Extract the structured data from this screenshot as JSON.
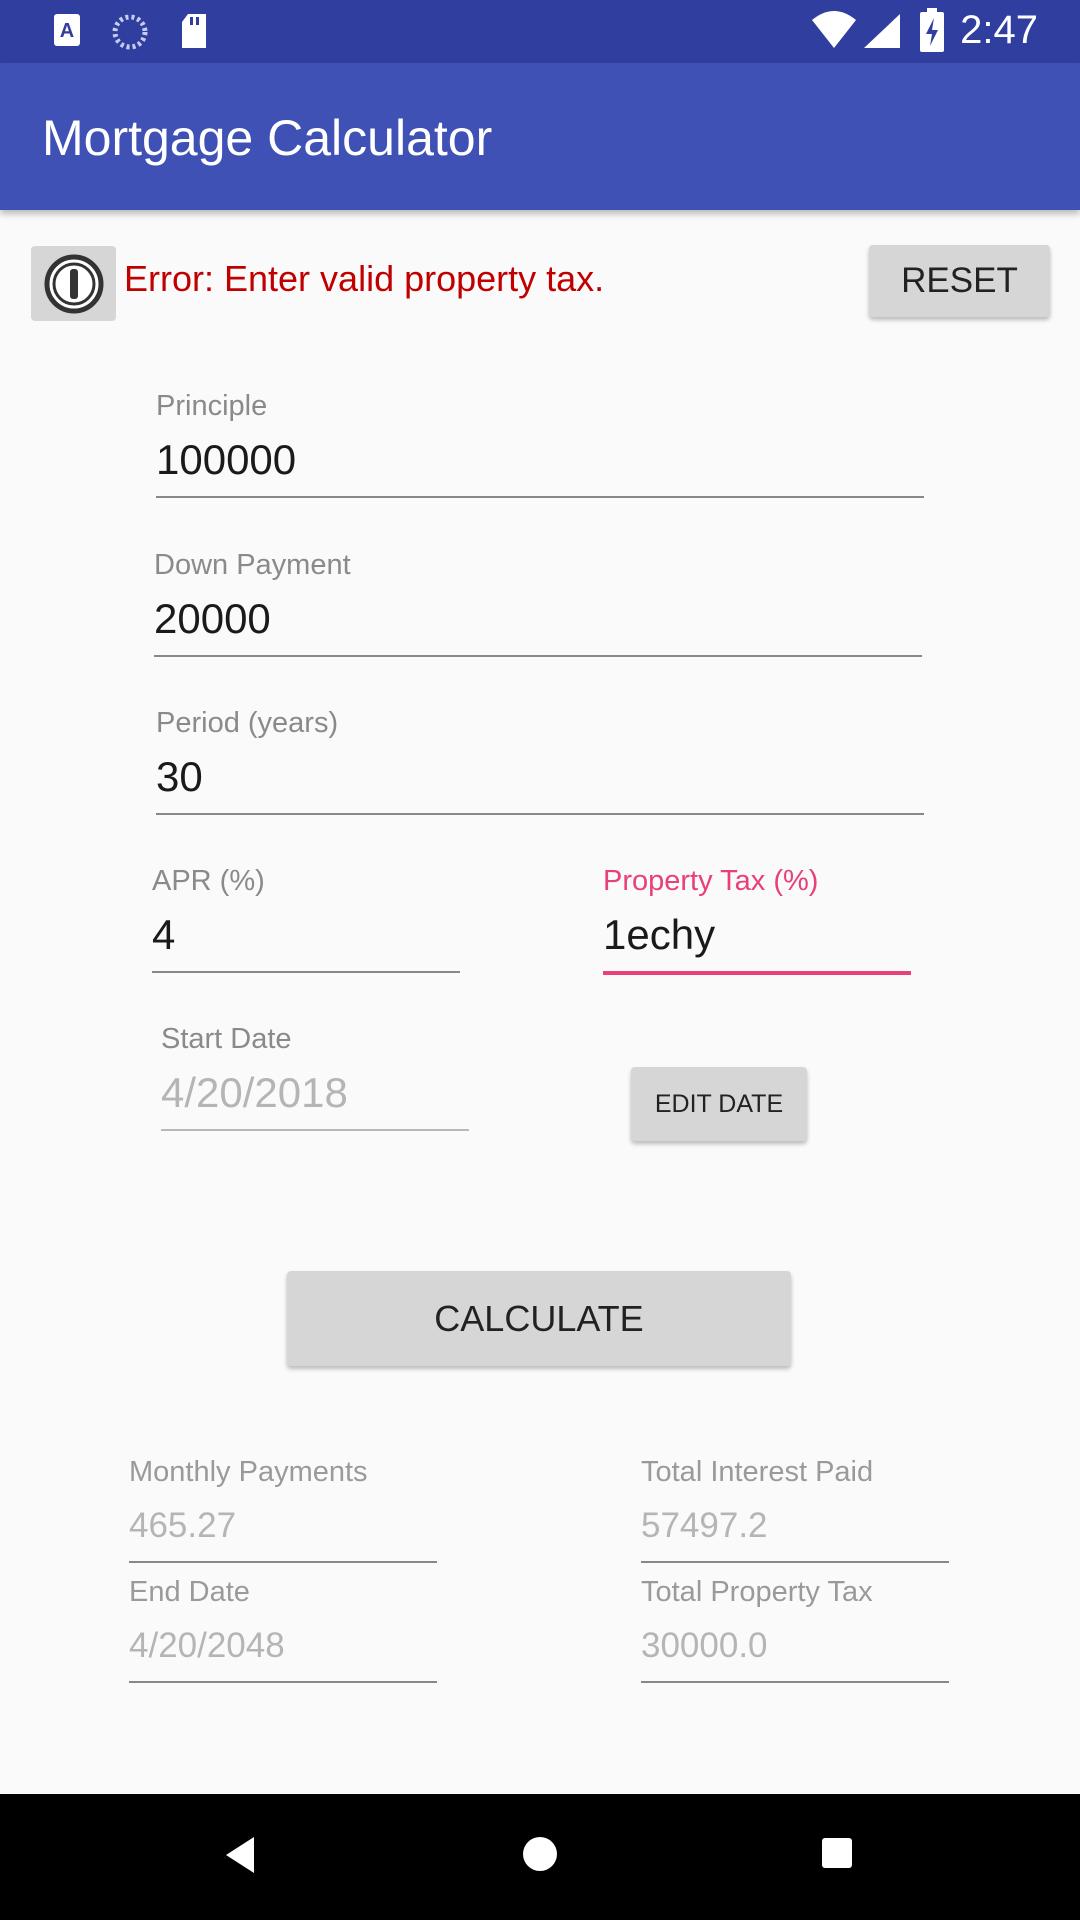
{
  "status_bar": {
    "time": "2:47",
    "icons": [
      "a-notification-icon",
      "sync-icon",
      "sd-card-icon",
      "wifi-icon",
      "signal-icon",
      "battery-charging-icon"
    ]
  },
  "app_bar": {
    "title": "Mortgage Calculator"
  },
  "error": {
    "message": "Error: Enter valid property tax."
  },
  "buttons": {
    "reset": "RESET",
    "edit_date": "EDIT DATE",
    "calculate": "CALCULATE"
  },
  "form": {
    "principle": {
      "label": "Principle",
      "value": "100000"
    },
    "down_payment": {
      "label": "Down Payment",
      "value": "20000"
    },
    "period": {
      "label": "Period (years)",
      "value": "30"
    },
    "apr": {
      "label": "APR (%)",
      "value": "4"
    },
    "property_tax": {
      "label": "Property Tax (%)",
      "value": "1echy"
    },
    "start_date": {
      "label": "Start Date",
      "value": "4/20/2018"
    }
  },
  "results": {
    "monthly_payments": {
      "label": "Monthly Payments",
      "value": "465.27"
    },
    "total_interest": {
      "label": "Total Interest Paid",
      "value": "57497.2"
    },
    "end_date": {
      "label": "End Date",
      "value": "4/20/2048"
    },
    "total_property_tax": {
      "label": "Total Property Tax",
      "value": "30000.0"
    }
  },
  "colors": {
    "status_bar": "#303f9f",
    "app_bar": "#3f51b5",
    "accent": "#e8407a",
    "error": "#c00000"
  },
  "nav_bar": {
    "icons": [
      "back-icon",
      "home-icon",
      "recents-icon"
    ]
  }
}
